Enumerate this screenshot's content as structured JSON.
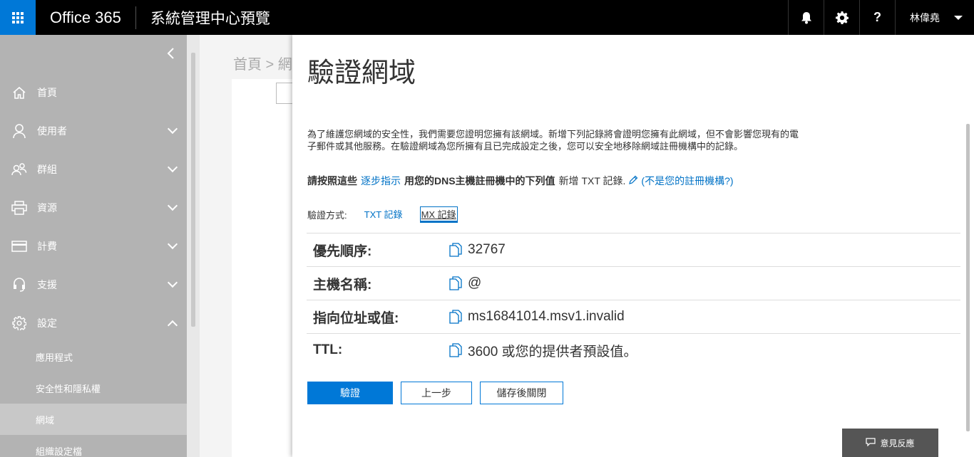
{
  "topbar": {
    "brand": "Office 365",
    "app_title": "系統管理中心預覽",
    "help_label": "?",
    "user_name": "林偉堯"
  },
  "sidebar": {
    "items": [
      {
        "label": "首頁",
        "icon": "home-icon"
      },
      {
        "label": "使用者",
        "icon": "user-icon"
      },
      {
        "label": "群組",
        "icon": "group-icon"
      },
      {
        "label": "資源",
        "icon": "printer-icon"
      },
      {
        "label": "計費",
        "icon": "credit-card-icon"
      },
      {
        "label": "支援",
        "icon": "headset-icon"
      },
      {
        "label": "設定",
        "icon": "gear-icon"
      }
    ],
    "subitems": [
      "應用程式",
      "安全性和隱私權",
      "網域",
      "組織設定檔"
    ],
    "active_subitem": "網域"
  },
  "background": {
    "breadcrumb": "首頁 > 網"
  },
  "flyout": {
    "title": "驗證網域",
    "description": "為了維護您網域的安全性，我們需要您證明您擁有該網域。新增下列記錄將會證明您擁有此網域，但不會影響您現有的電子郵件或其他服務。在驗證網域為您所擁有且已完成設定之後，您可以安全地移除網域註冊機構中的記錄。",
    "instruction": {
      "prefix": "請按照這些",
      "link": "逐步指示",
      "middle": "用您的DNS主機註冊機中的下列值",
      "suffix": "新增 TXT 記錄.",
      "registrar_link": "(不是您的註冊機構?)"
    },
    "method": {
      "label": "驗證方式:",
      "tabs": [
        "TXT 記錄",
        "MX 記錄"
      ],
      "active": "MX 記錄"
    },
    "records": [
      {
        "key": "優先順序:",
        "value": "32767"
      },
      {
        "key": "主機名稱:",
        "value": "@"
      },
      {
        "key": "指向位址或值:",
        "value": "ms16841014.msv1.invalid"
      },
      {
        "key": "TTL:",
        "value": "3600 或您的提供者預設值。"
      }
    ],
    "buttons": {
      "verify": "驗證",
      "back": "上一步",
      "save_close": "儲存後關閉"
    }
  },
  "feedback": {
    "label": "意見反應"
  },
  "colors": {
    "accent": "#0078d7",
    "link": "#0072c6",
    "sidebar": "#b3b3b3",
    "topbar": "#000000"
  }
}
